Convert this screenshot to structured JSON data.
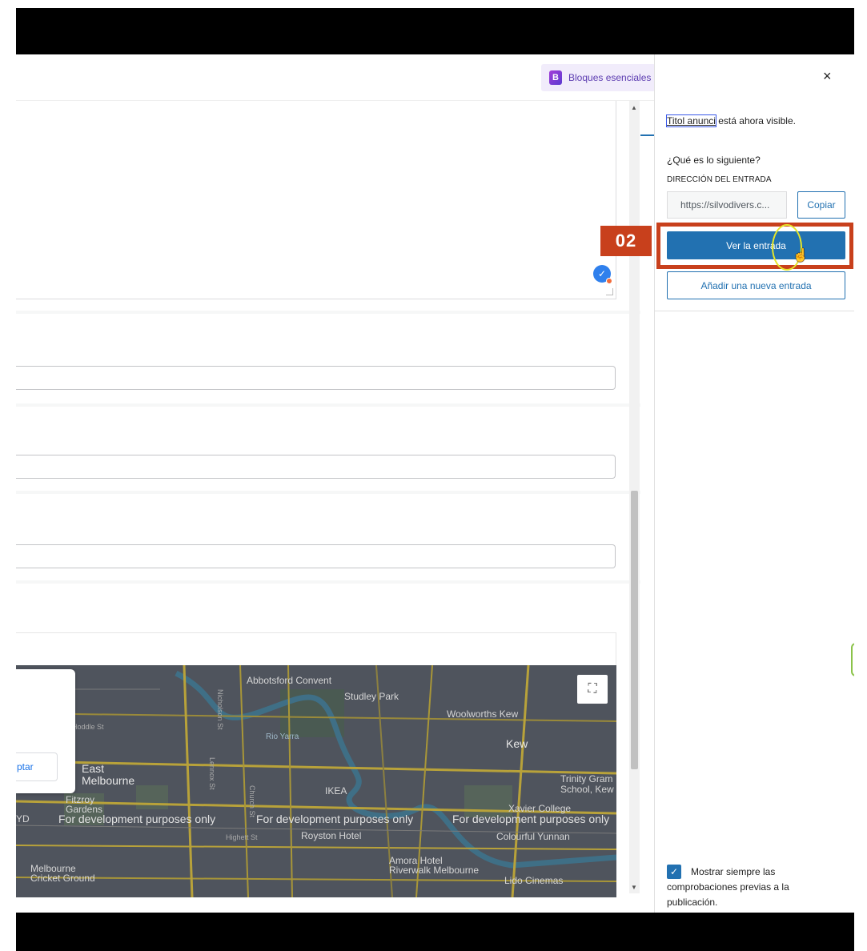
{
  "toolbar": {
    "bloques_label": "Bloques esenciales",
    "bloques_icon": "bloques-logo-icon"
  },
  "panel": {
    "close_icon": "×",
    "notice_link": "Titol anunci",
    "notice_text": " está ahora visible.",
    "next_question": "¿Qué es lo siguiente?",
    "address_label": "DIRECCIÓN DEL ENTRADA",
    "address_value": "https://silvodivers.c...",
    "copy_label": "Copiar",
    "view_label": "Ver la entrada",
    "add_label": "Añadir una nueva entrada",
    "prepublish_label": "Mostrar siempre las comprobaciones previas a la publicación.",
    "prepublish_checked": true,
    "accent_color": "#2271b1"
  },
  "annotation": {
    "step_number": "02",
    "color": "#c8401c"
  },
  "map": {
    "popup_button": "ptar",
    "dev_notice": "For development purposes only",
    "labels": {
      "abbotsford": "Abbotsford Convent",
      "studley": "Studley Park",
      "woolworths": "Woolworths Kew",
      "kew": "Kew",
      "east_melbourne": "East\nMelbourne",
      "ikea": "IKEA",
      "trinity": "Trinity Gram\nSchool, Kew",
      "xavier": "Xavier College",
      "fitzroy": "Fitzroy\nGardens",
      "royston": "Royston Hotel",
      "colourful": "Colourful Yunnan",
      "amora": "Amora Hotel\nRiverwalk Melbourne",
      "lido": "Lido Cinemas",
      "cricket": "Melbourne\nCricket Ground",
      "rio_yarra": "Rio Yarra",
      "hoddle": "Hoddle St",
      "nicholson": "Nicholson St",
      "church": "Church St",
      "lennox": "Lennox St",
      "highett": "Highett St",
      "yd": "YD"
    }
  }
}
